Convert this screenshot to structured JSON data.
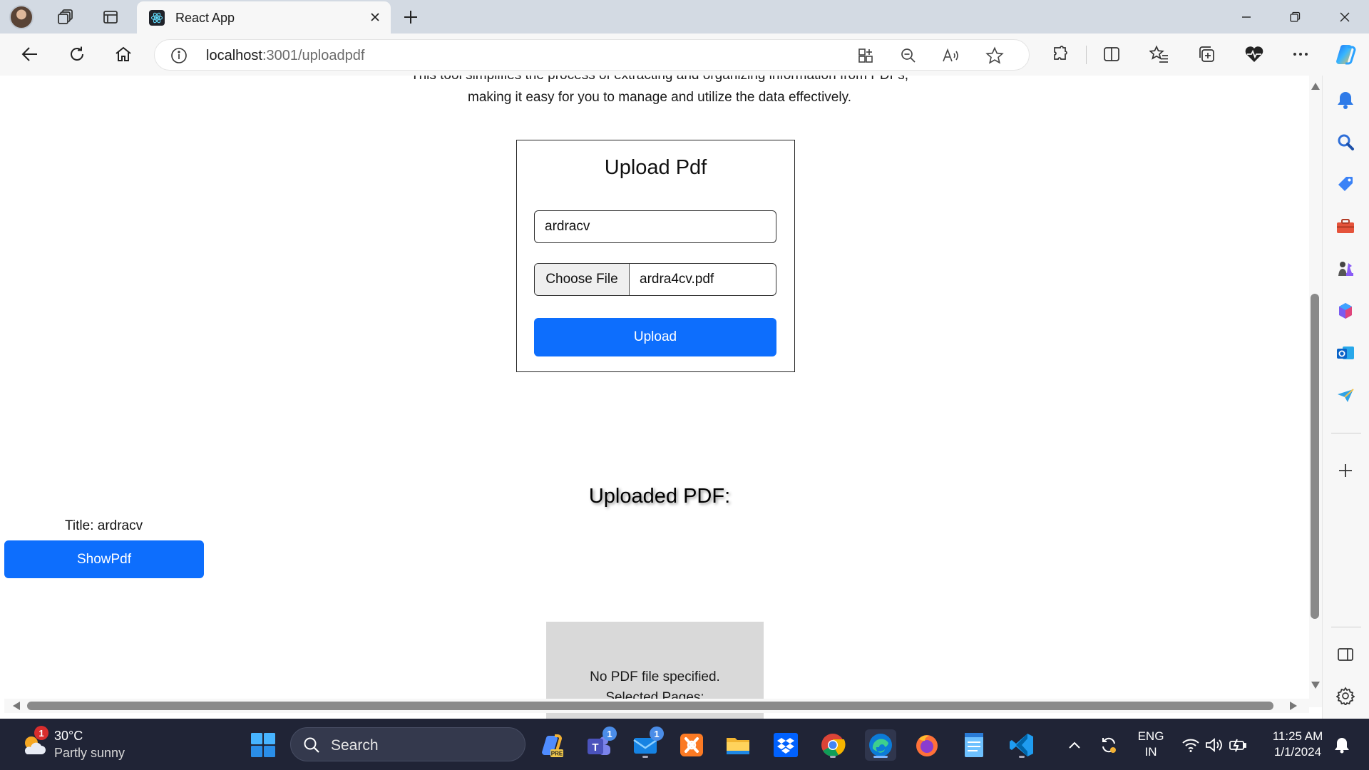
{
  "browser": {
    "tab_title": "React App",
    "url_host": "localhost",
    "url_path": ":3001/uploadpdf"
  },
  "page": {
    "intro_line1": "This tool simplifies the process of extracting and organizing information from PDFs,",
    "intro_line2": "making it easy for you to manage and utilize the data effectively.",
    "upload_card": {
      "title": "Upload Pdf",
      "title_value": "ardracv",
      "choose_file_label": "Choose File",
      "file_name": "ardra4cv.pdf",
      "upload_label": "Upload"
    },
    "uploaded_heading": "Uploaded PDF:",
    "item_title": "Title: ardracv",
    "show_pdf_label": "ShowPdf",
    "pdf_viewer": {
      "message": "No PDF file specified.",
      "selected_pages": "Selected Pages:"
    }
  },
  "taskbar": {
    "weather_badge": "1",
    "weather_temp": "30°C",
    "weather_desc": "Partly sunny",
    "search_label": "Search",
    "teams_badge": "1",
    "mail_badge": "1",
    "lang_line1": "ENG",
    "lang_line2": "IN",
    "time": "11:25 AM",
    "date": "1/1/2024"
  },
  "colors": {
    "primary_button": "#0d6efd",
    "taskbar_bg": "#202436",
    "tabstrip_bg": "#d3dae3"
  }
}
